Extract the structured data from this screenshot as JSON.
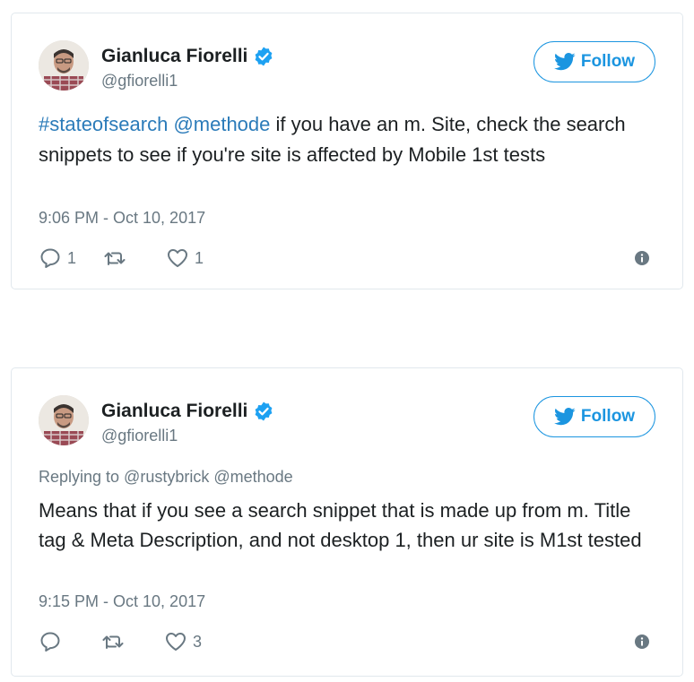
{
  "colors": {
    "link": "#2b7bb9",
    "follow": "#1b95e0",
    "muted": "#697882",
    "verified": "#1da1f2"
  },
  "tweets": [
    {
      "author": {
        "name": "Gianluca Fiorelli",
        "handle": "@gfiorelli1",
        "verified_icon": "verified-badge-icon"
      },
      "follow_label": "Follow",
      "text": {
        "hashtag": "#stateofsearch",
        "mention": "@methode",
        "body": " if you have an m. Site, check the search snippets to see if you're site is affected by Mobile 1st tests"
      },
      "timestamp": "9:06 PM - Oct 10, 2017",
      "actions": {
        "reply_count": "1",
        "retweet_count": "",
        "like_count": "1"
      }
    },
    {
      "author": {
        "name": "Gianluca Fiorelli",
        "handle": "@gfiorelli1",
        "verified_icon": "verified-badge-icon"
      },
      "follow_label": "Follow",
      "replying_to": "Replying to @rustybrick @methode",
      "text": {
        "body": "Means that if you see a search snippet that is made up from m. Title tag & Meta Description, and not desktop 1, then ur site is M1st tested"
      },
      "timestamp": "9:15 PM - Oct 10, 2017",
      "actions": {
        "reply_count": "",
        "retweet_count": "",
        "like_count": "3"
      }
    }
  ]
}
